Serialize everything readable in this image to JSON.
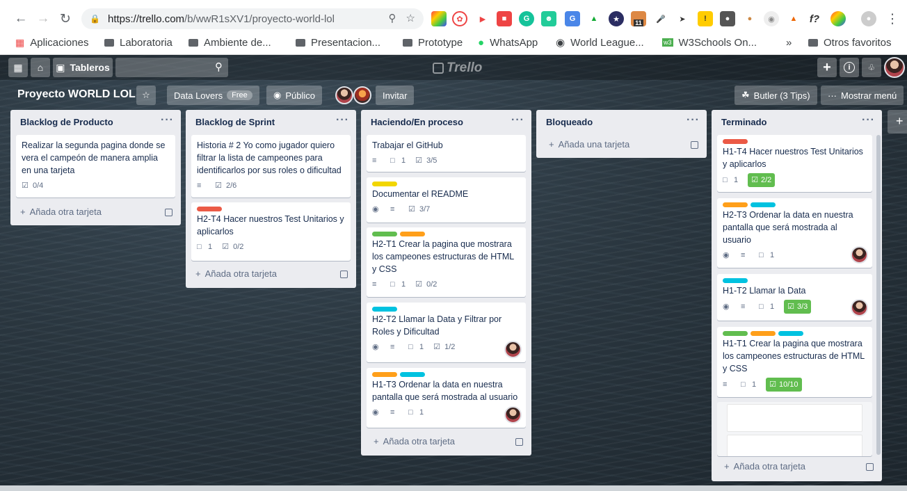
{
  "browser": {
    "url_host": "https://trello.com",
    "url_path": "/b/wwR1sXV1/proyecto-world-lol",
    "bookmarks": [
      "Aplicaciones",
      "Laboratoria",
      "Ambiente de...",
      "Presentacion...",
      "Prototype",
      "WhatsApp",
      "World League...",
      "W3Schools On...",
      "Otros favoritos"
    ],
    "overflow": "»",
    "ext_badge": "11"
  },
  "topbar": {
    "boards_label": "Tableros",
    "logo": "Trello",
    "plus": "+",
    "info": "i",
    "bell": "🔔"
  },
  "board": {
    "title": "Proyecto WORLD LOL",
    "team": "Data Lovers",
    "team_badge": "Free",
    "visibility": "Público",
    "invite": "Invitar",
    "butler": "Butler (3 Tips)",
    "menu": "Mostrar menú"
  },
  "lists": [
    {
      "title": "Blacklog de Producto",
      "add": "Añada otra tarjeta",
      "cards": [
        {
          "text": "Realizar la segunda pagina donde se vera el campeón de manera amplia en una tarjeta",
          "check": "0/4"
        }
      ]
    },
    {
      "title": "Blacklog de Sprint",
      "add": "Añada otra tarjeta",
      "cards": [
        {
          "text": "Historia # 2 Yo como jugador quiero filtrar la lista de campeones para identificarlos por sus roles o dificultad",
          "check": "2/6"
        },
        {
          "text": "H2-T4 Hacer nuestros Test Unitarios y aplicarlos",
          "comments": "1",
          "check": "0/2"
        }
      ]
    },
    {
      "title": "Haciendo/En proceso",
      "add": "Añada otra tarjeta",
      "cards": [
        {
          "text": "Trabajar el GitHub",
          "comments": "1",
          "check": "3/5"
        },
        {
          "text": "Documentar el README",
          "check": "3/7"
        },
        {
          "text": "H2-T1 Crear la pagina que mostrara los campeones estructuras de HTML y CSS",
          "comments": "1",
          "check": "0/2"
        },
        {
          "text": "H2-T2 Llamar la Data y Filtrar por Roles y Dificultad",
          "comments": "1",
          "check": "1/2"
        },
        {
          "text": "H1-T3 Ordenar la data en nuestra pantalla que será mostrada al usuario",
          "comments": "1"
        }
      ]
    },
    {
      "title": "Bloqueado",
      "add": "Añada una tarjeta",
      "cards": []
    },
    {
      "title": "Terminado",
      "add": "Añada otra tarjeta",
      "cards": [
        {
          "text": "H1-T4 Hacer nuestros Test Unitarios y aplicarlos",
          "comments": "1",
          "check": "2/2"
        },
        {
          "text": "H2-T3 Ordenar la data en nuestra pantalla que será mostrada al usuario",
          "comments": "1"
        },
        {
          "text": "H1-T2 Llamar la Data",
          "comments": "1",
          "check": "3/3"
        },
        {
          "text": "H1-T1 Crear la pagina que mostrara los campeones estructuras de HTML y CSS",
          "comments": "1",
          "check": "10/10"
        }
      ]
    }
  ],
  "colors": {
    "green": "#61bd4f",
    "yellow": "#f2d600",
    "orange": "#ff9f1a",
    "red": "#eb5a46",
    "sky": "#00c2e0"
  }
}
